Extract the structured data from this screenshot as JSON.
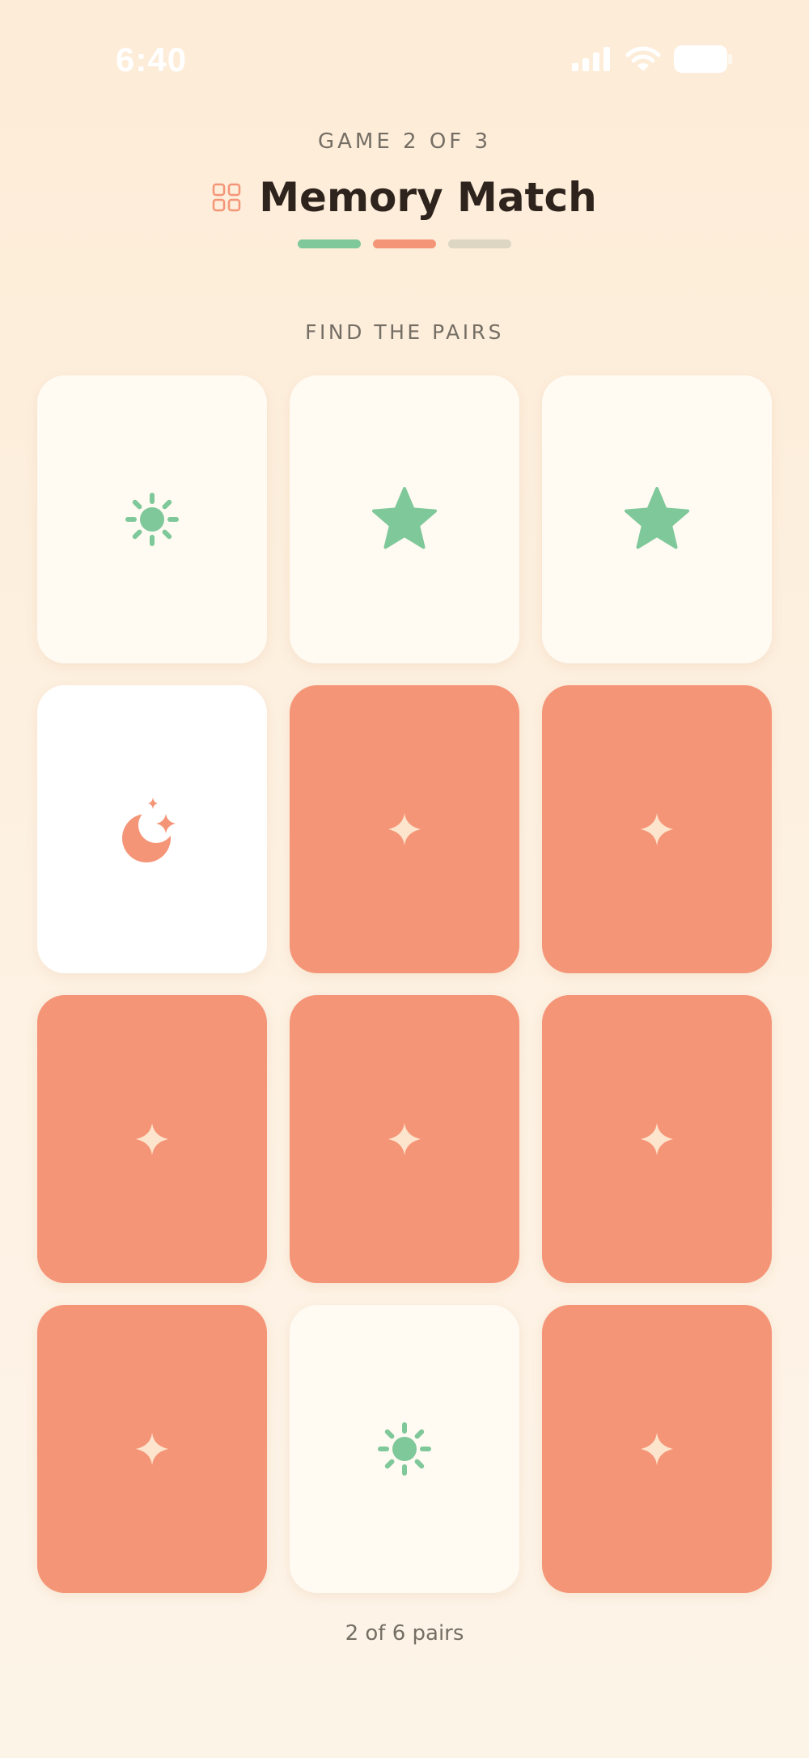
{
  "status": {
    "time": "6:40",
    "icons": [
      "signal-icon",
      "wifi-icon",
      "battery-icon"
    ]
  },
  "header": {
    "game_label": "GAME 2 OF 3",
    "title": "Memory Match",
    "icon": "grid-icon",
    "progress": [
      {
        "state": "complete",
        "color": "#7fc89a"
      },
      {
        "state": "current",
        "color": "#f59577"
      },
      {
        "state": "upcoming",
        "color": "#ddd6c2"
      }
    ]
  },
  "board": {
    "subtitle": "FIND THE PAIRS",
    "cards": [
      {
        "state": "revealed",
        "symbol": "sun-icon"
      },
      {
        "state": "revealed",
        "symbol": "star-icon"
      },
      {
        "state": "revealed",
        "symbol": "star-icon"
      },
      {
        "state": "revealed",
        "symbol": "moon-stars-icon"
      },
      {
        "state": "hidden",
        "symbol": "sparkle-icon"
      },
      {
        "state": "hidden",
        "symbol": "sparkle-icon"
      },
      {
        "state": "hidden",
        "symbol": "sparkle-icon"
      },
      {
        "state": "hidden",
        "symbol": "sparkle-icon"
      },
      {
        "state": "hidden",
        "symbol": "sparkle-icon"
      },
      {
        "state": "hidden",
        "symbol": "sparkle-icon"
      },
      {
        "state": "revealed",
        "symbol": "sun-icon"
      },
      {
        "state": "hidden",
        "symbol": "sparkle-icon"
      }
    ]
  },
  "footer": {
    "pairs_text": "2 of 6 pairs"
  },
  "colors": {
    "accent": "#f59577",
    "green": "#7fc89a",
    "card_face": "#fffaf2",
    "text_muted": "#756e64",
    "title": "#2e241d"
  }
}
